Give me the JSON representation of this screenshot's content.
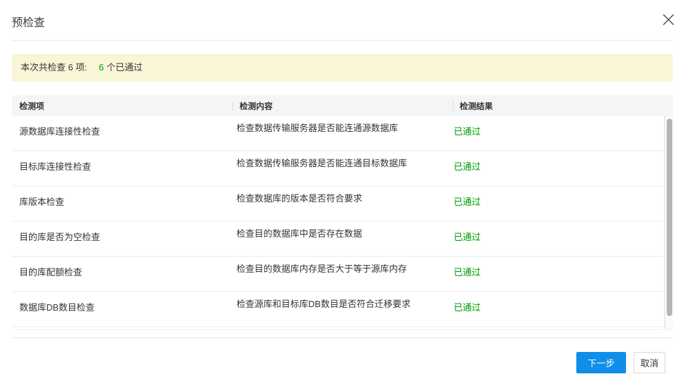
{
  "dialog": {
    "title": "预检查"
  },
  "icons": {
    "close": "x-cross"
  },
  "summary": {
    "prefix": "本次共检查 6 项:",
    "passed_count": "6",
    "passed_suffix": "个已通过"
  },
  "table": {
    "columns": [
      "检测项",
      "检测内容",
      "检测结果"
    ],
    "rows": [
      {
        "item": "源数据库连接性检查",
        "content": "检查数据传输服务器是否能连通源数据库",
        "result": "已通过"
      },
      {
        "item": "目标库连接性检查",
        "content": "检查数据传输服务器是否能连通目标数据库",
        "result": "已通过"
      },
      {
        "item": "库版本检查",
        "content": "检查数据库的版本是否符合要求",
        "result": "已通过"
      },
      {
        "item": "目的库是否为空检查",
        "content": "检查目的数据库中是否存在数据",
        "result": "已通过"
      },
      {
        "item": "目的库配额检查",
        "content": "检查目的数据库内存是否大于等于源库内存",
        "result": "已通过"
      },
      {
        "item": "数据库DB数目检查",
        "content": "检查源库和目标库DB数目是否符合迁移要求",
        "result": "已通过"
      }
    ]
  },
  "footer": {
    "next_label": "下一步",
    "cancel_label": "取消"
  },
  "colors": {
    "pass_green": "#009900",
    "banner_bg": "#f9f5d7",
    "primary_blue": "#108ee9"
  }
}
